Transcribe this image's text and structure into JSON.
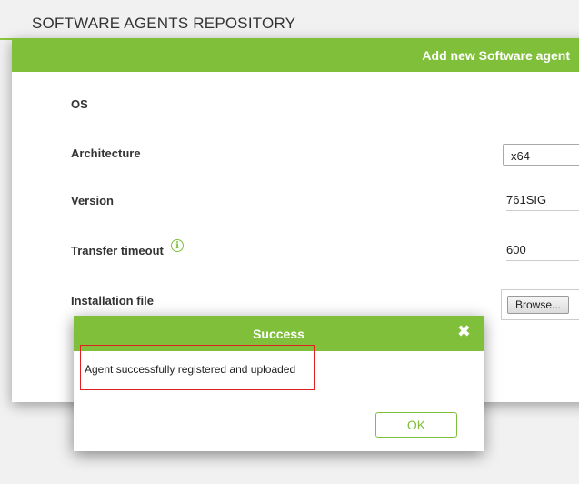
{
  "page": {
    "title": "SOFTWARE AGENTS REPOSITORY"
  },
  "modal": {
    "title": "Add new Software agent",
    "fields": {
      "os": {
        "label": "OS"
      },
      "architecture": {
        "label": "Architecture",
        "value": "x64"
      },
      "version": {
        "label": "Version",
        "value": "761SIG"
      },
      "transfer_timeout": {
        "label": "Transfer timeout",
        "value": "600",
        "info_icon": "i"
      },
      "installation_file": {
        "label": "Installation file",
        "button_label": "Browse..."
      }
    }
  },
  "dialog": {
    "title": "Success",
    "close_symbol": "✖",
    "message": "Agent successfully registered and uploaded",
    "ok_label": "OK"
  },
  "colors": {
    "accent": "#7fbf3a",
    "highlight_border": "#e02020"
  }
}
